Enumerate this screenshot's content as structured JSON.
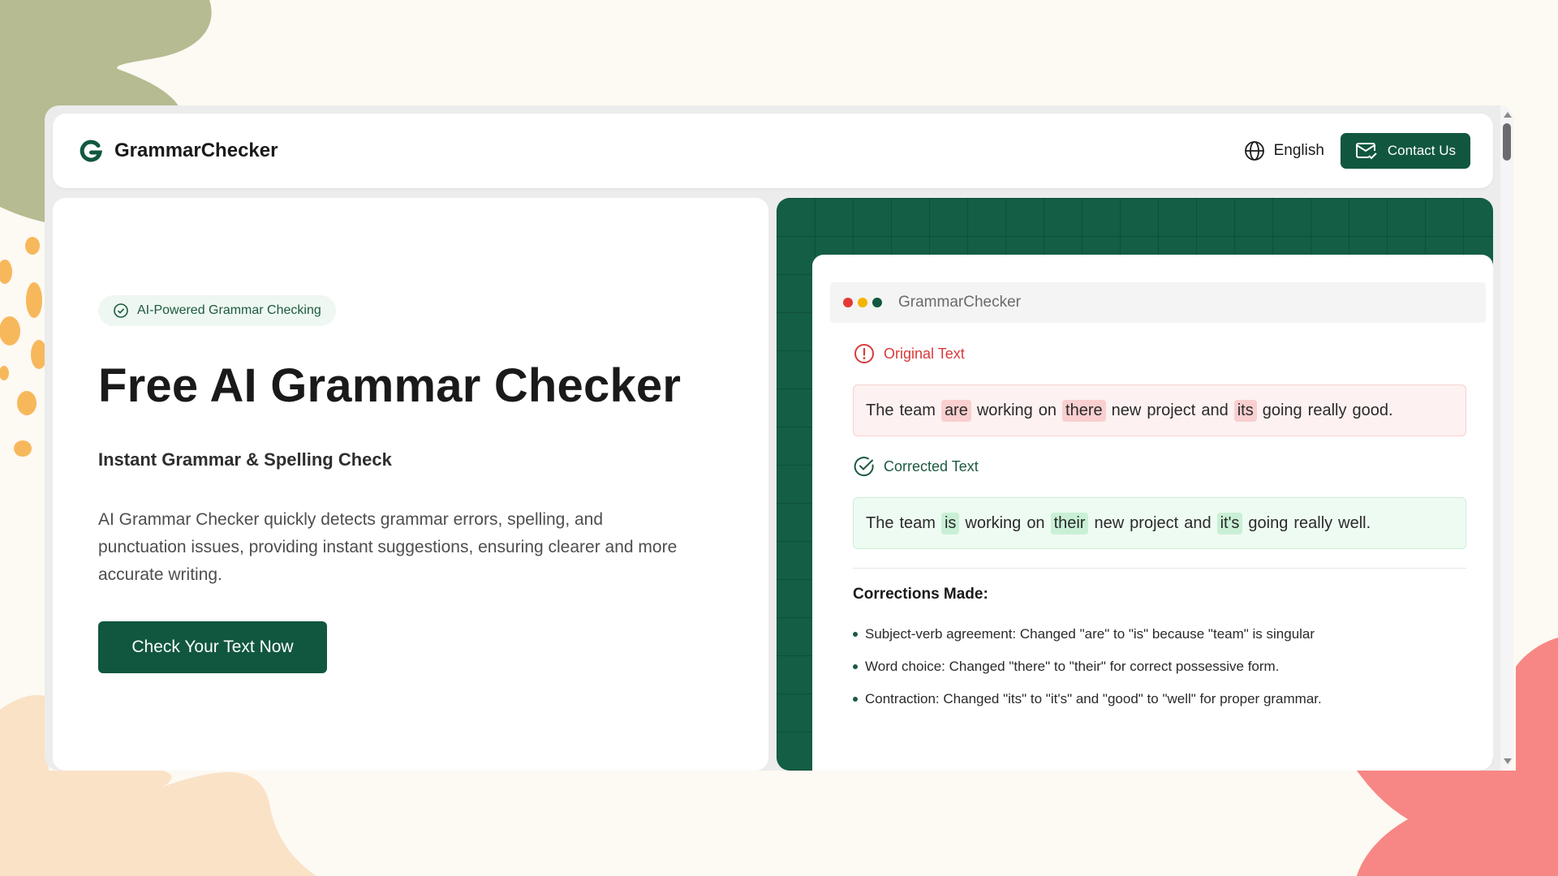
{
  "theme": {
    "brand_green": "#11573f",
    "panel_green": "#135e45",
    "error_red": "#d93a3a",
    "error_highlight": "#f9cfcf",
    "success_highlight": "#c9f0d6",
    "page_background": "#fdf9f3"
  },
  "header": {
    "brand_icon": "g-logo-icon",
    "brand_name": "GrammarChecker",
    "language_icon": "globe-icon",
    "language_label": "English",
    "contact_icon": "mail-check-icon",
    "contact_label": "Contact Us"
  },
  "hero": {
    "badge_icon": "check-circle-icon",
    "badge": "AI-Powered Grammar Checking",
    "title": "Free AI Grammar Checker",
    "subtitle": "Instant Grammar & Spelling Check",
    "description": "AI Grammar Checker quickly detects grammar errors, spelling, and punctuation issues, providing instant suggestions, ensuring clearer and more accurate writing.",
    "cta_label": "Check Your Text Now"
  },
  "demo": {
    "window_title": "GrammarChecker",
    "window_dots": [
      "#e53935",
      "#f4b400",
      "#11573f"
    ],
    "original_icon": "alert-circle-icon",
    "original_label": "Original Text",
    "original_tokens": [
      "The",
      "team",
      "are",
      "working",
      "on",
      "there",
      "new",
      "project",
      "and",
      "its",
      "going",
      "really",
      "good."
    ],
    "original_flagged_indices": [
      2,
      5,
      9
    ],
    "corrected_icon": "check-circle-icon",
    "corrected_label": "Corrected Text",
    "corrected_tokens": [
      "The",
      "team",
      "is",
      "working",
      "on",
      "their",
      "new",
      "project",
      "and",
      "it's",
      "going",
      "really",
      "well."
    ],
    "corrected_fixed_indices": [
      2,
      5,
      9
    ],
    "corrections_title": "Corrections Made:",
    "corrections": [
      "Subject-verb agreement: Changed \"are\" to \"is\" because \"team\" is singular",
      "Word choice: Changed \"there\" to \"their\" for correct possessive form.",
      "Contraction: Changed \"its\" to \"it's\" and \"good\" to \"well\" for proper grammar."
    ]
  }
}
